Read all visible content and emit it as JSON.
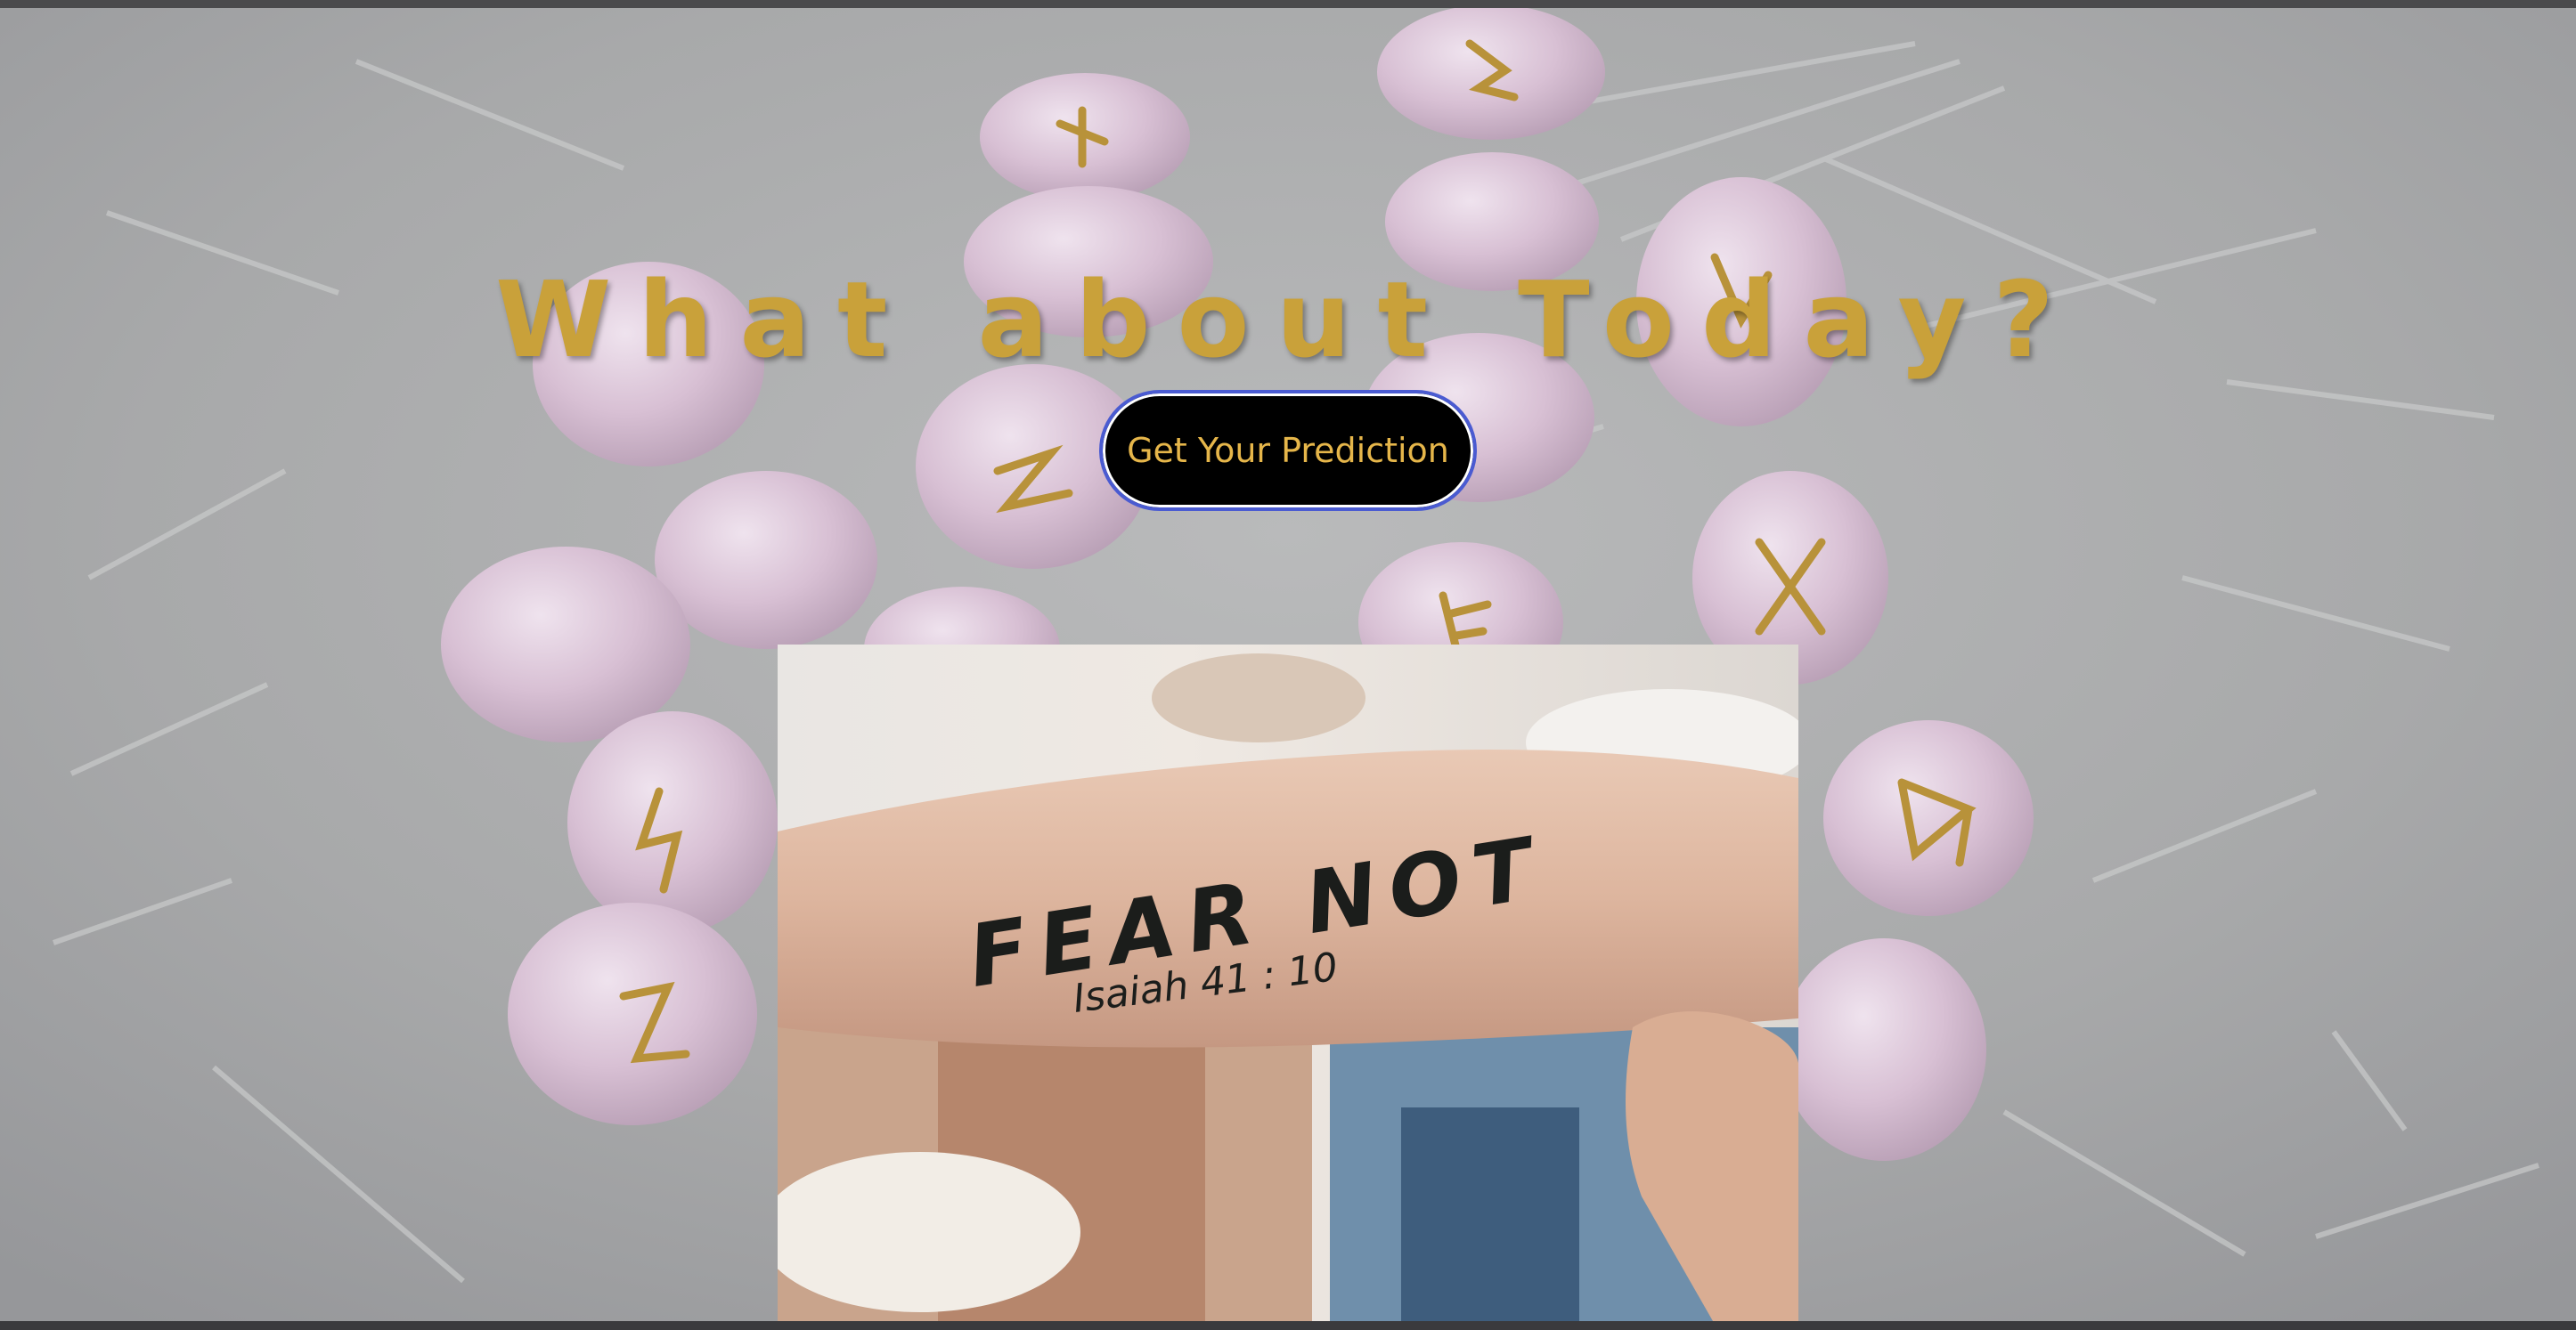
{
  "hero": {
    "headline": "What about Today?",
    "cta_label": "Get Your Prediction"
  },
  "photo": {
    "tattoo_main": "FEAR NOT",
    "tattoo_sub": "Isaiah 41 : 10"
  },
  "colors": {
    "accent_gold": "#c9a13a",
    "button_bg": "#000000",
    "button_border": "#4a5bd1",
    "background_stone": "#a9aaab",
    "crystal": "#d7bfd3"
  },
  "icons": {
    "background": "rune-stones-image",
    "photo": "forearm-tattoo-image"
  }
}
